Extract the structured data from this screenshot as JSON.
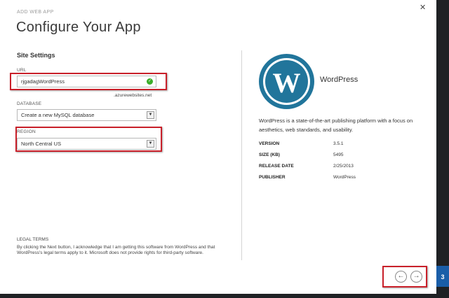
{
  "dialog": {
    "subtitle": "ADD WEB APP",
    "title": "Configure Your App",
    "close_icon": "close-icon",
    "step_number": "3"
  },
  "site_settings": {
    "section_title": "Site Settings",
    "url": {
      "label": "URL",
      "value": "rjgadagWordPress",
      "suffix": ".azurewebsites.net",
      "status_icon": "check-circle-icon",
      "status_color": "#3cae2a"
    },
    "database": {
      "label": "DATABASE",
      "selected": "Create a new MySQL database"
    },
    "region": {
      "label": "REGION",
      "selected": "North Central US"
    }
  },
  "legal": {
    "title": "LEGAL TERMS",
    "text": "By clicking the Next button, I acknowledge that I am getting this software from WordPress and that WordPress's legal terms apply to it. Microsoft does not provide rights for third-party software."
  },
  "app_info": {
    "logo_icon": "wordpress-logo",
    "name": "WordPress",
    "description": "WordPress is a state-of-the-art publishing platform with a focus on aesthetics, web standards, and usability.",
    "details": [
      {
        "key": "VERSION",
        "value": "3.5.1"
      },
      {
        "key": "SIZE (KB)",
        "value": "5495"
      },
      {
        "key": "RELEASE DATE",
        "value": "2/25/2013"
      },
      {
        "key": "PUBLISHER",
        "value": "WordPress"
      }
    ]
  },
  "navigation": {
    "back_icon": "arrow-left-icon",
    "next_icon": "arrow-right-icon"
  },
  "colors": {
    "highlight": "#c9202a",
    "wordpress_blue": "#21759b",
    "accent": "#1a5ea8"
  }
}
